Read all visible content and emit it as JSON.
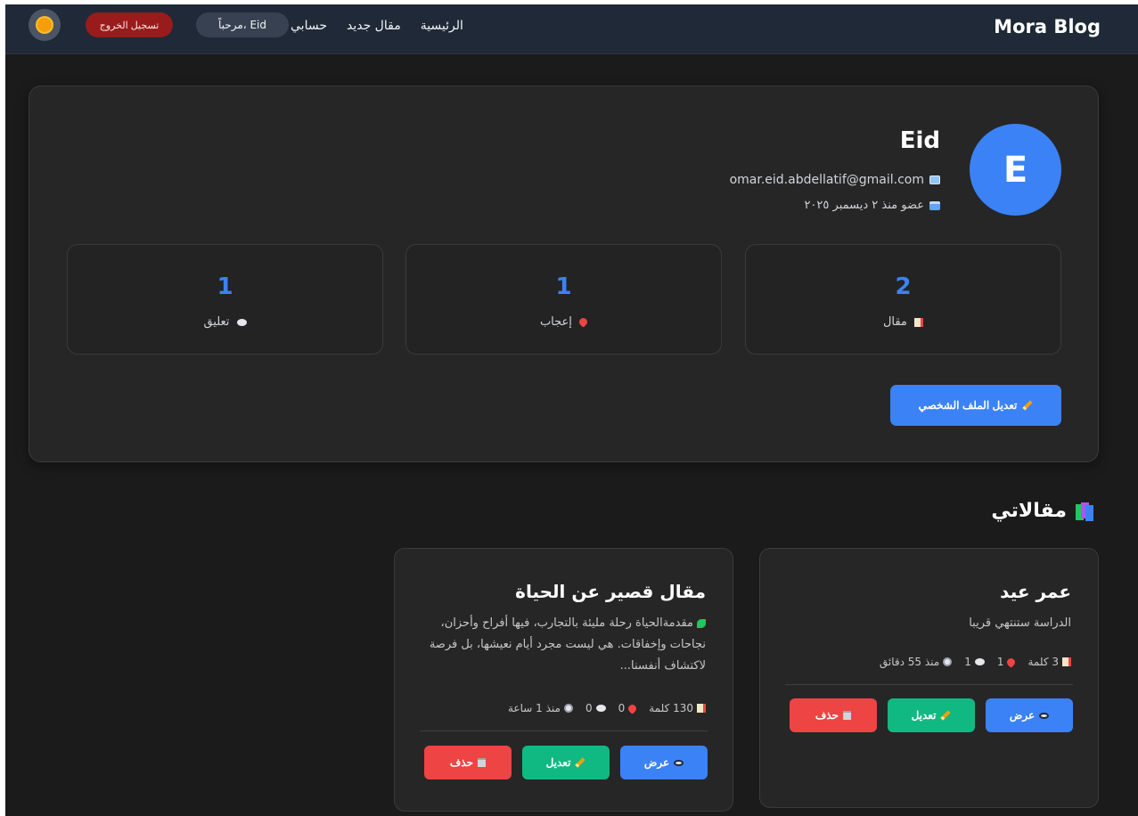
{
  "navbar": {
    "brand": "Mora Blog",
    "links": [
      "الرئيسية",
      "مقال جديد",
      "حسابي"
    ],
    "welcome": "مرحباً، Eid",
    "logout": "تسجيل الخروج",
    "theme_icon": "sun-icon"
  },
  "profile": {
    "avatar_letter": "E",
    "name": "Eid",
    "email": "omar.eid.abdellatif@gmail.com",
    "joined": "عضو منذ ٢ ديسمبر ٢٠٢٥",
    "stats": [
      {
        "value": "2",
        "label": "مقال",
        "icon": "document-icon"
      },
      {
        "value": "1",
        "label": "إعجاب",
        "icon": "heart-icon"
      },
      {
        "value": "1",
        "label": "تعليق",
        "icon": "comment-icon"
      }
    ],
    "edit_button": "تعديل الملف الشخصي"
  },
  "articles_section": {
    "title": "مقالاتي",
    "articles": [
      {
        "title": "عمر عيد",
        "excerpt": "الدراسة ستنتهي قريبا",
        "words": "3 كلمة",
        "likes": "1",
        "comments": "1",
        "time": "منذ 55 دقائق",
        "view": "عرض",
        "edit": "تعديل",
        "delete": "حذف"
      },
      {
        "title": "مقال قصير عن الحياة",
        "excerpt": "مقدمةالحياة رحلة مليئة بالتجارب، فيها أفراح وأحزان، نجاحات وإخفاقات. هي ليست مجرد أيام نعيشها، بل فرصة لاكتشاف أنفسنا...",
        "words": "130 كلمة",
        "likes": "0",
        "comments": "0",
        "time": "منذ 1 ساعة",
        "view": "عرض",
        "edit": "تعديل",
        "delete": "حذف"
      }
    ]
  },
  "colors": {
    "accent": "#3b82f6",
    "success": "#10b981",
    "danger": "#ef4444",
    "navbar": "#1f2937",
    "card": "#262626"
  }
}
